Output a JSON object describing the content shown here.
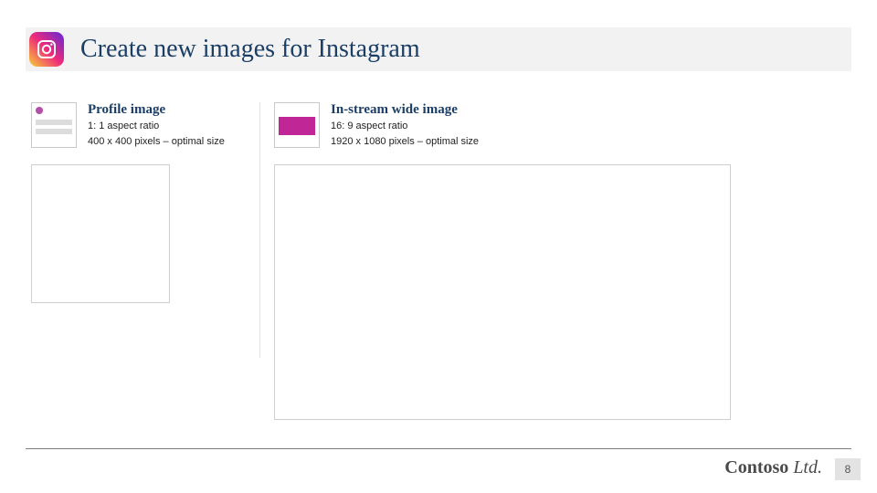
{
  "title": "Create new images for Instagram",
  "icon_name": "instagram-icon",
  "specs": {
    "profile": {
      "heading": "Profile image",
      "ratio": "1: 1 aspect ratio",
      "size": "400 x 400 pixels – optimal size"
    },
    "wide": {
      "heading": "In-stream wide image",
      "ratio": "16: 9 aspect ratio",
      "size": "1920 x 1080 pixels – optimal size"
    }
  },
  "footer": {
    "brand_bold": "Contoso",
    "brand_light": " Ltd.",
    "page": "8"
  }
}
